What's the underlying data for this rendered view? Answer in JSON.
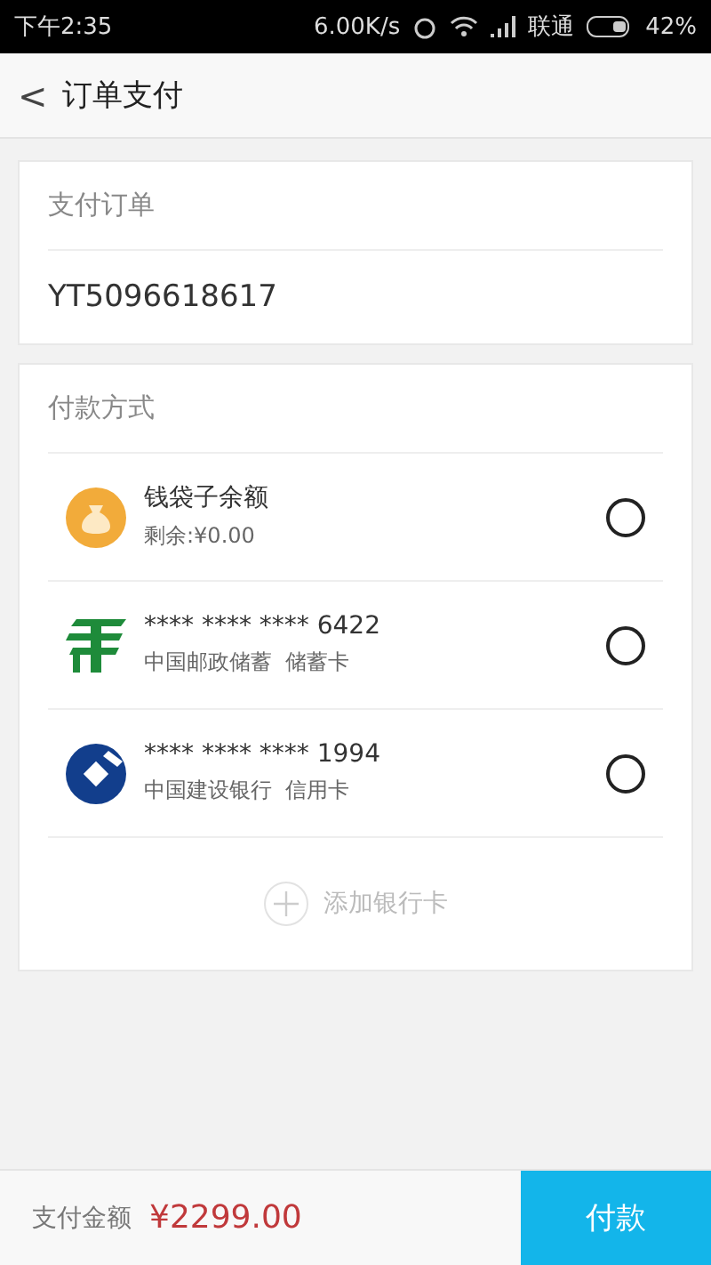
{
  "status_bar": {
    "time": "下午2:35",
    "speed": "6.00K/s",
    "carrier": "联通",
    "battery": "42%"
  },
  "header": {
    "back": "<",
    "title": "订单支付"
  },
  "order": {
    "label": "支付订单",
    "number": "YT5096618617"
  },
  "payment": {
    "label": "付款方式",
    "methods": [
      {
        "kind": "wallet",
        "title": "钱袋子余额",
        "subtitle": "剩余:¥0.00",
        "selected": false
      },
      {
        "kind": "postal",
        "title": "**** **** **** 6422",
        "subtitle": "中国邮政储蓄  储蓄卡",
        "selected": false
      },
      {
        "kind": "ccb",
        "title": "**** **** **** 1994",
        "subtitle": "中国建设银行  信用卡",
        "selected": false
      }
    ],
    "add_card": "添加银行卡"
  },
  "footer": {
    "label": "支付金额",
    "amount": "¥2299.00",
    "pay_button": "付款"
  }
}
